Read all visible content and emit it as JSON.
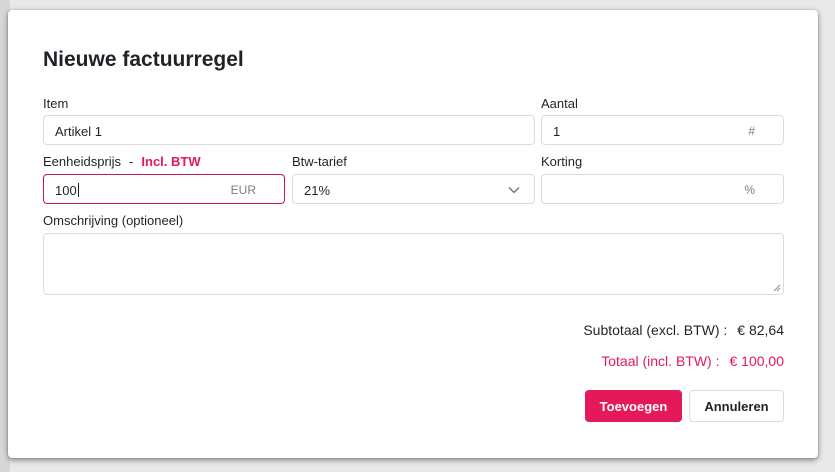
{
  "dialog": {
    "title": "Nieuwe factuurregel"
  },
  "fields": {
    "item": {
      "label": "Item",
      "value": "Artikel 1"
    },
    "quantity": {
      "label": "Aantal",
      "value": "1",
      "suffix": "#"
    },
    "unit_price": {
      "label": "Eenheidsprijs",
      "separator": "-",
      "tax_mode": "Incl. BTW",
      "value": "100",
      "suffix": "EUR"
    },
    "vat_rate": {
      "label": "Btw-tarief",
      "selected": "21%"
    },
    "discount": {
      "label": "Korting",
      "value": "",
      "suffix": "%"
    },
    "description": {
      "label": "Omschrijving (optioneel)",
      "value": ""
    }
  },
  "totals": {
    "subtotal_label": "Subtotaal (excl. BTW) :",
    "subtotal_value": "€ 82,64",
    "total_label": "Totaal (incl. BTW) :",
    "total_value": "€ 100,00"
  },
  "actions": {
    "add_label": "Toevoegen",
    "cancel_label": "Annuleren"
  },
  "colors": {
    "accent": "#e5185a",
    "focus_border": "#c61a4a",
    "text": "#1f2328",
    "muted": "#7a7d82",
    "border": "#dcdcde"
  },
  "icons": {
    "vat_dropdown": "chevron-down-icon",
    "description_resize": "resize-grip-icon"
  }
}
